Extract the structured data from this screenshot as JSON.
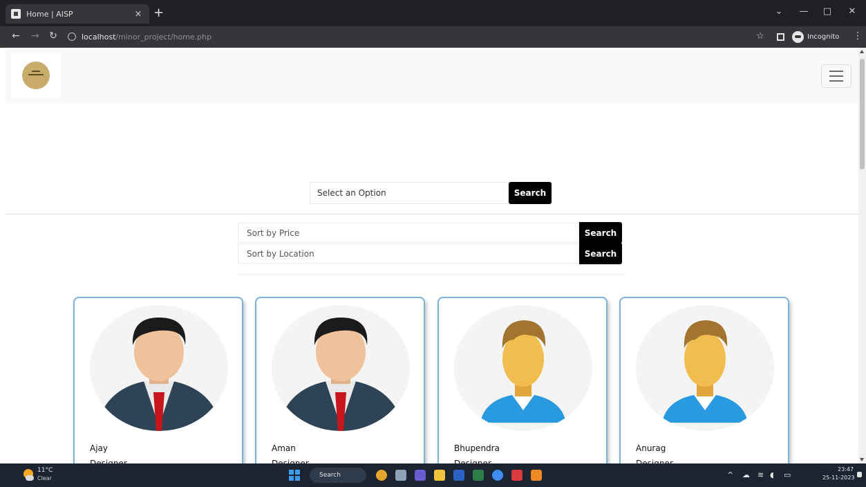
{
  "browser": {
    "tab_title": "Home | AISP",
    "tab_close": "×",
    "new_tab": "+",
    "url_host": "localhost",
    "url_path": "/minor_project/home.php",
    "profile_label": "Incognito"
  },
  "window_controls": {
    "minimize": "⌄",
    "restore": "—",
    "maximize": "□",
    "close": "✕"
  },
  "nav_buttons": {
    "back": "←",
    "forward": "→",
    "reload": "↻"
  },
  "filter": {
    "select_placeholder": "Select an Option",
    "search_label": "Search"
  },
  "sort": {
    "price_placeholder": "Sort by Price",
    "price_button": "Search",
    "location_placeholder": "Sort by Location",
    "location_button": "Search"
  },
  "cards": [
    {
      "name": "Ajay",
      "role": "Designer",
      "avatar": "male-suit-avatar"
    },
    {
      "name": "Aman",
      "role": "Designer",
      "avatar": "male-suit-avatar"
    },
    {
      "name": "Bhupendra",
      "role": "Designer",
      "avatar": "male-casual-avatar"
    },
    {
      "name": "Anurag",
      "role": "Designer",
      "avatar": "male-casual-avatar"
    }
  ],
  "taskbar": {
    "weather_temp": "11°C",
    "weather_condition": "Clear",
    "search_label": "Search",
    "clock_time": "23:47",
    "clock_date": "25-11-2023"
  },
  "colors": {
    "card_border": "#7cb3d6",
    "button_bg": "#000000",
    "nav_bg": "#f8f9fa",
    "logo": "#c9ab6b"
  }
}
